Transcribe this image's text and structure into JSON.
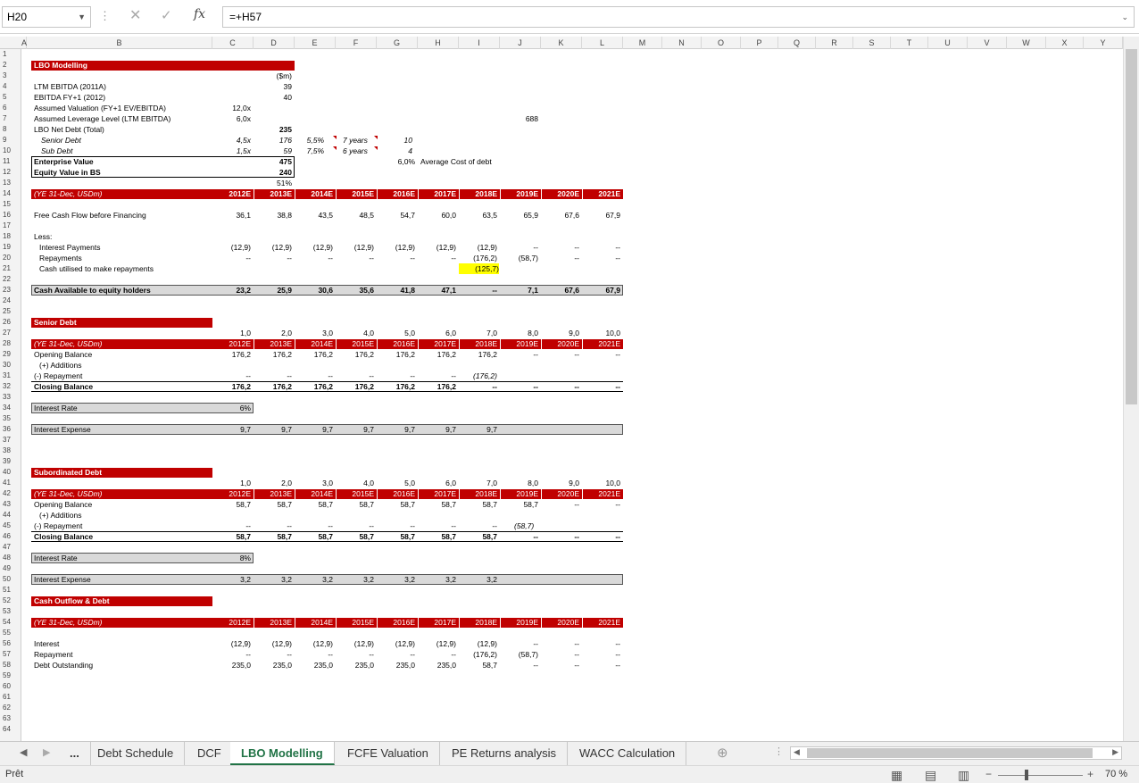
{
  "formula_bar": {
    "name_box": "H20",
    "formula": "=+H57",
    "fx": "fx"
  },
  "columns": [
    "A",
    "B",
    "C",
    "D",
    "E",
    "F",
    "G",
    "H",
    "I",
    "J",
    "K",
    "L",
    "M",
    "N",
    "O",
    "P",
    "Q",
    "R",
    "S",
    "T",
    "U",
    "V",
    "W",
    "X",
    "Y"
  ],
  "sheet": {
    "title": "LBO Modelling",
    "unit": "($m)",
    "assumptions": [
      {
        "label": "LTM EBITDA (2011A)",
        "d": "39"
      },
      {
        "label": "EBITDA FY+1 (2012)",
        "d": "40"
      },
      {
        "label": "Assumed Valuation (FY+1 EV/EBITDA)",
        "c": "12,0x"
      },
      {
        "label": "Assumed Leverage Level (LTM EBITDA)",
        "c": "6,0x",
        "i": "688"
      },
      {
        "label": "LBO Net Debt (Total)",
        "d": "235"
      }
    ],
    "senior_row": {
      "label": "Senior Debt",
      "c": "4,5x",
      "d": "176",
      "e": "5,5%",
      "f": "7 years",
      "g": "10"
    },
    "sub_row": {
      "label": "Sub Debt",
      "c": "1,5x",
      "d": "59",
      "e": "7,5%",
      "f": "6 years",
      "g": "4"
    },
    "ev": {
      "label": "Enterprise Value",
      "value": "475",
      "avg_cost": "6,0%",
      "avg_cost_label": "Average Cost of debt"
    },
    "equity": {
      "label": "Equity Value in BS",
      "value": "240",
      "pct": "51%"
    },
    "years": [
      "2012E",
      "2013E",
      "2014E",
      "2015E",
      "2016E",
      "2017E",
      "2018E",
      "2019E",
      "2020E",
      "2021E"
    ],
    "period_label": "(YE 31-Dec, USDm)",
    "fcf": {
      "label": "Free Cash Flow before Financing",
      "values": [
        "36,1",
        "38,8",
        "43,5",
        "48,5",
        "54,7",
        "60,0",
        "63,5",
        "65,9",
        "67,6",
        "67,9"
      ]
    },
    "less": "Less:",
    "interest_payments": {
      "label": "Interest Payments",
      "values": [
        "(12,9)",
        "(12,9)",
        "(12,9)",
        "(12,9)",
        "(12,9)",
        "(12,9)",
        "(12,9)",
        "--",
        "--",
        "--"
      ]
    },
    "repayments": {
      "label": "Repayments",
      "values": [
        "--",
        "--",
        "--",
        "--",
        "--",
        "--",
        "(176,2)",
        "(58,7)",
        "--",
        "--"
      ]
    },
    "cash_utilised": {
      "label": "Cash utilised to make repayments",
      "value": "(125,7)"
    },
    "cash_avail": {
      "label": "Cash Available to equity holders",
      "values": [
        "23,2",
        "25,9",
        "30,6",
        "35,6",
        "41,8",
        "47,1",
        "--",
        "7,1",
        "67,6",
        "67,9"
      ]
    },
    "period_nums": [
      "1,0",
      "2,0",
      "3,0",
      "4,0",
      "5,0",
      "6,0",
      "7,0",
      "8,0",
      "9,0",
      "10,0"
    ],
    "senior": {
      "title": "Senior Debt",
      "opening": {
        "label": "Opening Balance",
        "values": [
          "176,2",
          "176,2",
          "176,2",
          "176,2",
          "176,2",
          "176,2",
          "176,2",
          "--",
          "--",
          "--"
        ]
      },
      "additions": "(+) Additions",
      "repayment": {
        "label": "(-) Repayment",
        "values": [
          "--",
          "--",
          "--",
          "--",
          "--",
          "--",
          "(176,2)",
          "",
          "",
          ""
        ]
      },
      "closing": {
        "label": "Closing Balance",
        "values": [
          "176,2",
          "176,2",
          "176,2",
          "176,2",
          "176,2",
          "176,2",
          "--",
          "--",
          "--",
          "--"
        ]
      },
      "rate": {
        "label": "Interest Rate",
        "value": "6%"
      },
      "expense": {
        "label": "Interest Expense",
        "values": [
          "9,7",
          "9,7",
          "9,7",
          "9,7",
          "9,7",
          "9,7",
          "9,7"
        ]
      }
    },
    "sub": {
      "title": "Subordinated Debt",
      "opening": {
        "label": "Opening Balance",
        "values": [
          "58,7",
          "58,7",
          "58,7",
          "58,7",
          "58,7",
          "58,7",
          "58,7",
          "58,7",
          "--",
          "--"
        ]
      },
      "additions": "(+) Additions",
      "repayment": {
        "label": "(-) Repayment",
        "values": [
          "--",
          "--",
          "--",
          "--",
          "--",
          "--",
          "--",
          "(58,7)",
          "",
          ""
        ]
      },
      "closing": {
        "label": "Closing Balance",
        "values": [
          "58,7",
          "58,7",
          "58,7",
          "58,7",
          "58,7",
          "58,7",
          "58,7",
          "--",
          "--",
          "--"
        ]
      },
      "rate": {
        "label": "Interest Rate",
        "value": "8%"
      },
      "expense": {
        "label": "Interest Expense",
        "values": [
          "3,2",
          "3,2",
          "3,2",
          "3,2",
          "3,2",
          "3,2",
          "3,2"
        ]
      }
    },
    "outflow": {
      "title": "Cash Outflow & Debt",
      "interest": {
        "label": "Interest",
        "values": [
          "(12,9)",
          "(12,9)",
          "(12,9)",
          "(12,9)",
          "(12,9)",
          "(12,9)",
          "(12,9)",
          "--",
          "--",
          "--"
        ]
      },
      "repayment": {
        "label": "Repayment",
        "values": [
          "--",
          "--",
          "--",
          "--",
          "--",
          "--",
          "(176,2)",
          "(58,7)",
          "--",
          "--"
        ]
      },
      "outstanding": {
        "label": "Debt Outstanding",
        "values": [
          "235,0",
          "235,0",
          "235,0",
          "235,0",
          "235,0",
          "235,0",
          "58,7",
          "--",
          "--",
          "--"
        ]
      }
    }
  },
  "tabs": [
    "...",
    "Debt Schedule",
    "DCF",
    "LBO Modelling",
    "FCFE Valuation",
    "PE Returns analysis",
    "WACC Calculation"
  ],
  "active_tab": "LBO Modelling",
  "status": {
    "ready": "Prêt",
    "zoom": "70 %"
  },
  "colors": {
    "accent": "#c00000",
    "highlight": "#ffff00",
    "excel_green": "#217346"
  }
}
